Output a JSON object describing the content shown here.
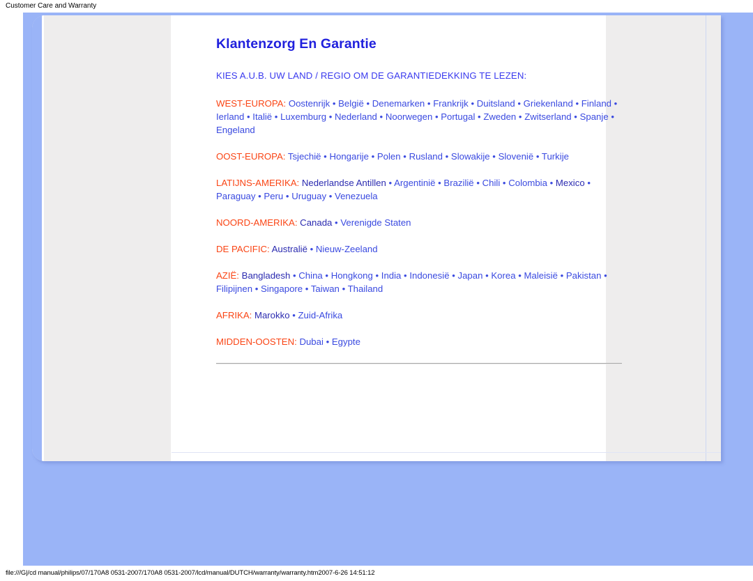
{
  "browser": {
    "header_title": "Customer Care and Warranty",
    "status_path": "file:///G|/cd manual/philips/07/170A8 0531-2007/170A8 0531-2007/lcd/manual/DUTCH/warranty/warranty.htm2007-6-26 14:51:12"
  },
  "colors": {
    "title_blue": "#2020dd",
    "subtitle_blue": "#3a3aee",
    "region_label_orange": "#fa4515",
    "link_blue": "#3a4ae0",
    "visited_link": "#2b2bb0",
    "backdrop_blue": "#9ab4f7",
    "panel_grey": "#eeeded"
  },
  "document": {
    "title": "Klantenzorg En Garantie",
    "subtitle": "KIES A.U.B. UW LAND / REGIO OM DE GARANTIEDEKKING TE LEZEN:",
    "separator": "•",
    "regions": [
      {
        "label": "WEST-EUROPA:",
        "countries": [
          {
            "name": "Oostenrijk",
            "visited": false
          },
          {
            "name": "België",
            "visited": false
          },
          {
            "name": "Denemarken",
            "visited": false
          },
          {
            "name": "Frankrijk",
            "visited": false
          },
          {
            "name": "Duitsland",
            "visited": false
          },
          {
            "name": "Griekenland",
            "visited": false
          },
          {
            "name": "Finland",
            "visited": false
          },
          {
            "name": "Ierland",
            "visited": false
          },
          {
            "name": "Italië",
            "visited": false
          },
          {
            "name": "Luxemburg",
            "visited": false
          },
          {
            "name": "Nederland",
            "visited": false
          },
          {
            "name": "Noorwegen",
            "visited": false
          },
          {
            "name": "Portugal",
            "visited": false
          },
          {
            "name": "Zweden",
            "visited": false
          },
          {
            "name": "Zwitserland",
            "visited": false
          },
          {
            "name": "Spanje",
            "visited": false
          },
          {
            "name": "Engeland",
            "visited": false
          }
        ]
      },
      {
        "label": "OOST-EUROPA:",
        "countries": [
          {
            "name": "Tsjechië",
            "visited": false
          },
          {
            "name": "Hongarije",
            "visited": false
          },
          {
            "name": "Polen",
            "visited": false
          },
          {
            "name": "Rusland",
            "visited": false
          },
          {
            "name": "Slowakije",
            "visited": false
          },
          {
            "name": "Slovenië",
            "visited": false
          },
          {
            "name": "Turkije",
            "visited": false
          }
        ]
      },
      {
        "label": "LATIJNS-AMERIKA:",
        "countries": [
          {
            "name": "Nederlandse Antillen",
            "visited": true
          },
          {
            "name": "Argentinië",
            "visited": false
          },
          {
            "name": "Brazilië",
            "visited": false
          },
          {
            "name": "Chili",
            "visited": false
          },
          {
            "name": "Colombia",
            "visited": false
          },
          {
            "name": "Mexico",
            "visited": true
          },
          {
            "name": "Paraguay",
            "visited": false
          },
          {
            "name": "Peru",
            "visited": false
          },
          {
            "name": "Uruguay",
            "visited": false
          },
          {
            "name": "Venezuela",
            "visited": false
          }
        ]
      },
      {
        "label": "NOORD-AMERIKA:",
        "countries": [
          {
            "name": "Canada",
            "visited": true
          },
          {
            "name": "Verenigde Staten",
            "visited": false
          }
        ]
      },
      {
        "label": "DE PACIFIC:",
        "countries": [
          {
            "name": "Australië",
            "visited": true
          },
          {
            "name": "Nieuw-Zeeland",
            "visited": false
          }
        ]
      },
      {
        "label": "AZIË:",
        "countries": [
          {
            "name": "Bangladesh",
            "visited": true
          },
          {
            "name": "China",
            "visited": false
          },
          {
            "name": "Hongkong",
            "visited": false
          },
          {
            "name": "India",
            "visited": false
          },
          {
            "name": "Indonesië",
            "visited": false
          },
          {
            "name": "Japan",
            "visited": false
          },
          {
            "name": "Korea",
            "visited": false
          },
          {
            "name": "Maleisië",
            "visited": false
          },
          {
            "name": "Pakistan",
            "visited": false
          },
          {
            "name": "Filipijnen",
            "visited": false
          },
          {
            "name": "Singapore",
            "visited": false
          },
          {
            "name": "Taiwan",
            "visited": false
          },
          {
            "name": "Thailand",
            "visited": false
          }
        ]
      },
      {
        "label": "AFRIKA:",
        "countries": [
          {
            "name": "Marokko",
            "visited": true
          },
          {
            "name": "Zuid-Afrika",
            "visited": false
          }
        ]
      },
      {
        "label": "MIDDEN-OOSTEN:",
        "countries": [
          {
            "name": "Dubai",
            "visited": false
          },
          {
            "name": "Egypte",
            "visited": false
          }
        ]
      }
    ]
  }
}
